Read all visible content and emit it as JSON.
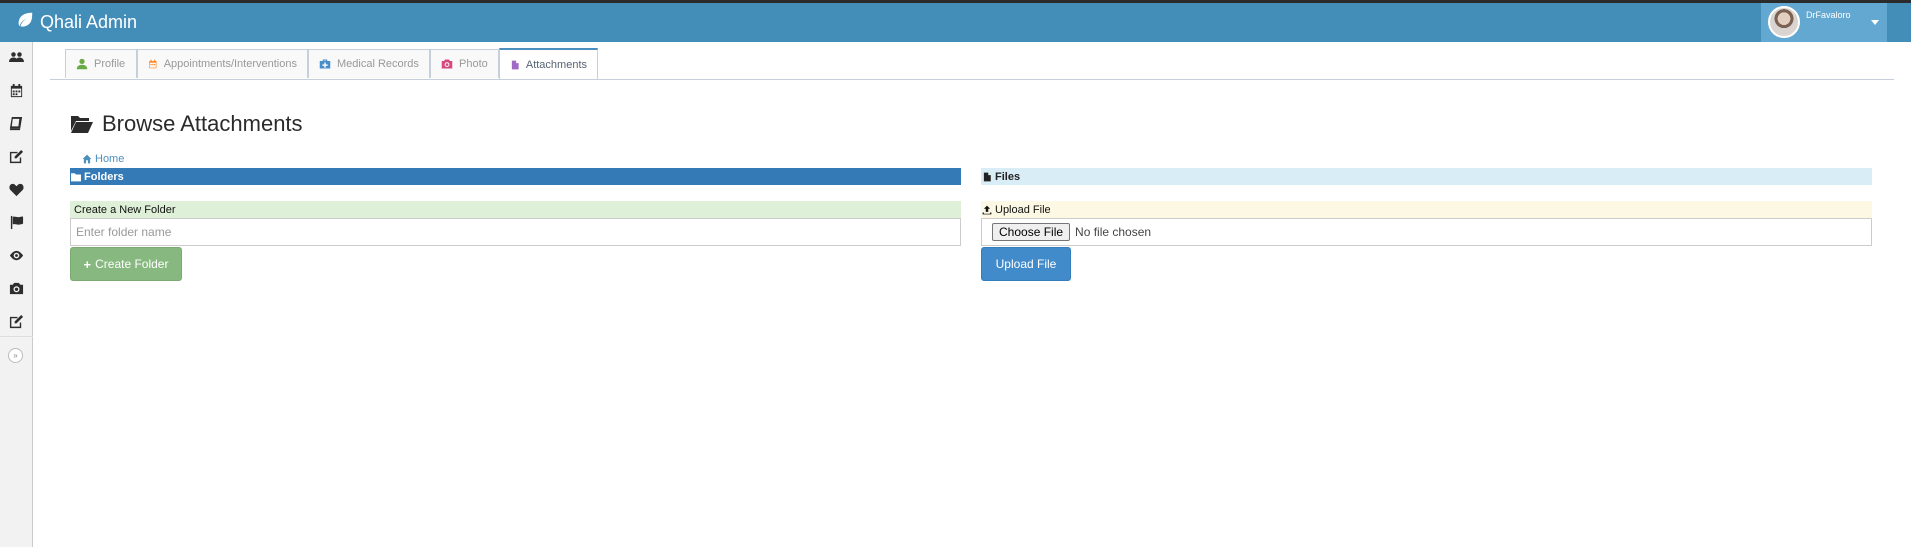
{
  "app": {
    "title": "Qhali Admin",
    "brand_color": "#438eb9",
    "icon": "leaf-icon"
  },
  "user": {
    "name": "DrFavaloro",
    "avatar_icon": "avatar"
  },
  "sidebar": {
    "items": [
      {
        "icon": "users-icon"
      },
      {
        "icon": "calendar-icon"
      },
      {
        "icon": "book-icon"
      },
      {
        "icon": "edit-icon"
      },
      {
        "icon": "heart-icon"
      },
      {
        "icon": "flag-icon"
      },
      {
        "icon": "eye-icon"
      },
      {
        "icon": "camera-icon"
      },
      {
        "icon": "edit-icon"
      }
    ],
    "toggle_icon": "double-chevron-right-icon"
  },
  "tabs": [
    {
      "label": "Profile",
      "icon": "user-icon",
      "icon_color": "#69aa46",
      "active": false
    },
    {
      "label": "Appointments/Interventions",
      "icon": "calendar-icon",
      "icon_color": "#ff892a",
      "active": false
    },
    {
      "label": "Medical Records",
      "icon": "medkit-icon",
      "icon_color": "#478fca",
      "active": false
    },
    {
      "label": "Photo",
      "icon": "camera-icon",
      "icon_color": "#d6487e",
      "active": false
    },
    {
      "label": "Attachments",
      "icon": "file-icon",
      "icon_color": "#a069c3",
      "active": true
    }
  ],
  "page": {
    "title": "Browse Attachments",
    "title_icon": "folder-open-icon"
  },
  "breadcrumb": {
    "home_label": "Home",
    "icon": "home-icon"
  },
  "folders_panel": {
    "header": "Folders",
    "header_color": "#337ab7",
    "create_section_label": "Create a New Folder",
    "input_placeholder": "Enter folder name",
    "input_value": "",
    "button_label": "Create Folder",
    "button_color": "#87b87f"
  },
  "files_panel": {
    "header": "Files",
    "header_color": "#d9edf7",
    "upload_section_label": "Upload File",
    "choose_button_label": "Choose File",
    "file_status": "No file chosen",
    "button_label": "Upload File",
    "button_color": "#428bca"
  }
}
